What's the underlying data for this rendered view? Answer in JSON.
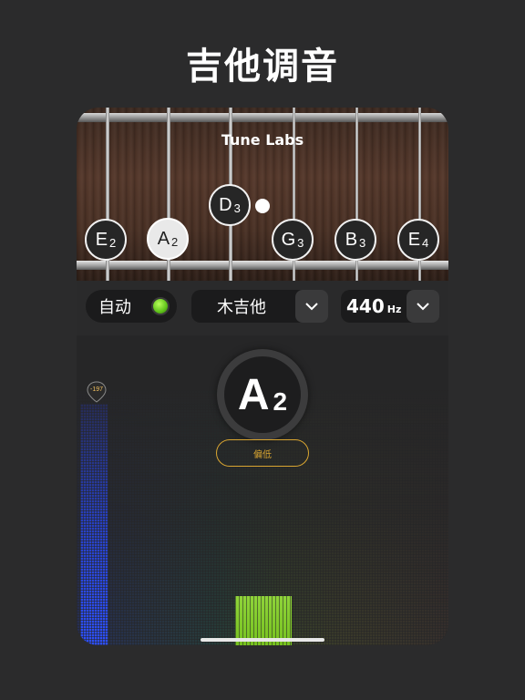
{
  "headline": "吉他调音",
  "app": {
    "brand": "Tune Labs"
  },
  "strings": [
    {
      "note": "E",
      "octave": "2",
      "active": false
    },
    {
      "note": "A",
      "octave": "2",
      "active": true
    },
    {
      "note": "D",
      "octave": "3",
      "active": false
    },
    {
      "note": "G",
      "octave": "3",
      "active": false
    },
    {
      "note": "B",
      "octave": "3",
      "active": false
    },
    {
      "note": "E",
      "octave": "4",
      "active": false
    }
  ],
  "controls": {
    "auto_label": "自动",
    "auto_enabled": true,
    "instrument": "木吉他",
    "frequency_value": "440",
    "frequency_unit": "Hz"
  },
  "tuner": {
    "current_note": "A",
    "current_octave": "2",
    "status": "偏低",
    "cents_marker": "-197"
  },
  "colors": {
    "accent": "#d9a531",
    "led_on": "#5fc21a",
    "bar_in_tune": "#8fd43a",
    "bar_low": "#2d50ff"
  }
}
